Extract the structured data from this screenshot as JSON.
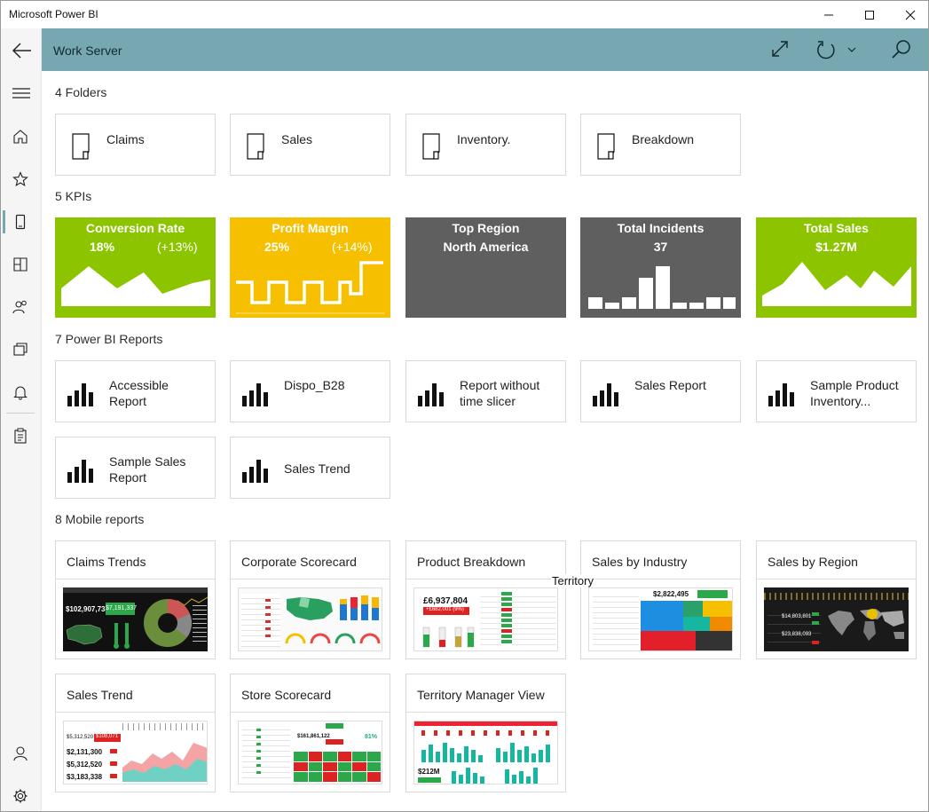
{
  "window": {
    "title": "Microsoft Power BI"
  },
  "header": {
    "title": "Work Server"
  },
  "sections": {
    "folders": "4 Folders",
    "kpis": "5 KPIs",
    "reports": "7 Power BI Reports",
    "mobile": "8 Mobile reports"
  },
  "folders": [
    "Claims",
    "Sales",
    "Inventory.",
    "Breakdown"
  ],
  "kpis": [
    {
      "title": "Conversion Rate",
      "value": "18%",
      "change": "(+13%)",
      "color": "#8dc400"
    },
    {
      "title": "Profit Margin",
      "value": "25%",
      "change": "(+14%)",
      "color": "#f6c000"
    },
    {
      "title": "Top Region",
      "value": "North America",
      "color": "#5f5f5f"
    },
    {
      "title": "Total Incidents",
      "value": "37",
      "color": "#5f5f5f"
    },
    {
      "title": "Total Sales",
      "value": "$1.27M",
      "color": "#8dc400"
    }
  ],
  "reports": [
    {
      "l1": "Accessible",
      "l2": "Report"
    },
    {
      "l1": "Dispo_B28",
      "l2": ""
    },
    {
      "l1": "Report without",
      "l2": "time slicer"
    },
    {
      "l1": "Sales Report",
      "l2": ""
    },
    {
      "l1": "Sample Product",
      "l2": "Inventory..."
    },
    {
      "l1": "Sample Sales",
      "l2": "Report"
    },
    {
      "l1": "Sales Trend",
      "l2": ""
    }
  ],
  "mobile": [
    {
      "title": "Claims Trends",
      "nums": [
        "$102,907,738",
        "$7,191,337"
      ]
    },
    {
      "title": "Corporate Scorecard"
    },
    {
      "title": "Product Breakdown",
      "nums": [
        "£6,937,804",
        "+£682,001 (9%)"
      ]
    },
    {
      "title": "Sales by Industry",
      "nums": [
        "$2,822,495"
      ]
    },
    {
      "title": "Sales by Region",
      "nums": [
        "$14,803,801",
        "$23,838,093"
      ]
    },
    {
      "title": "Sales Trend",
      "nums": [
        "$5,312,520",
        "$108,071",
        "$2,131,300",
        "$5,312,520",
        "$3,183,338"
      ]
    },
    {
      "title": "Store Scorecard",
      "nums": [
        "$161,861,122",
        "81%"
      ]
    },
    {
      "title": "Territory Manager View",
      "nums": [
        "$212M"
      ]
    }
  ],
  "tooltip": "Territory"
}
